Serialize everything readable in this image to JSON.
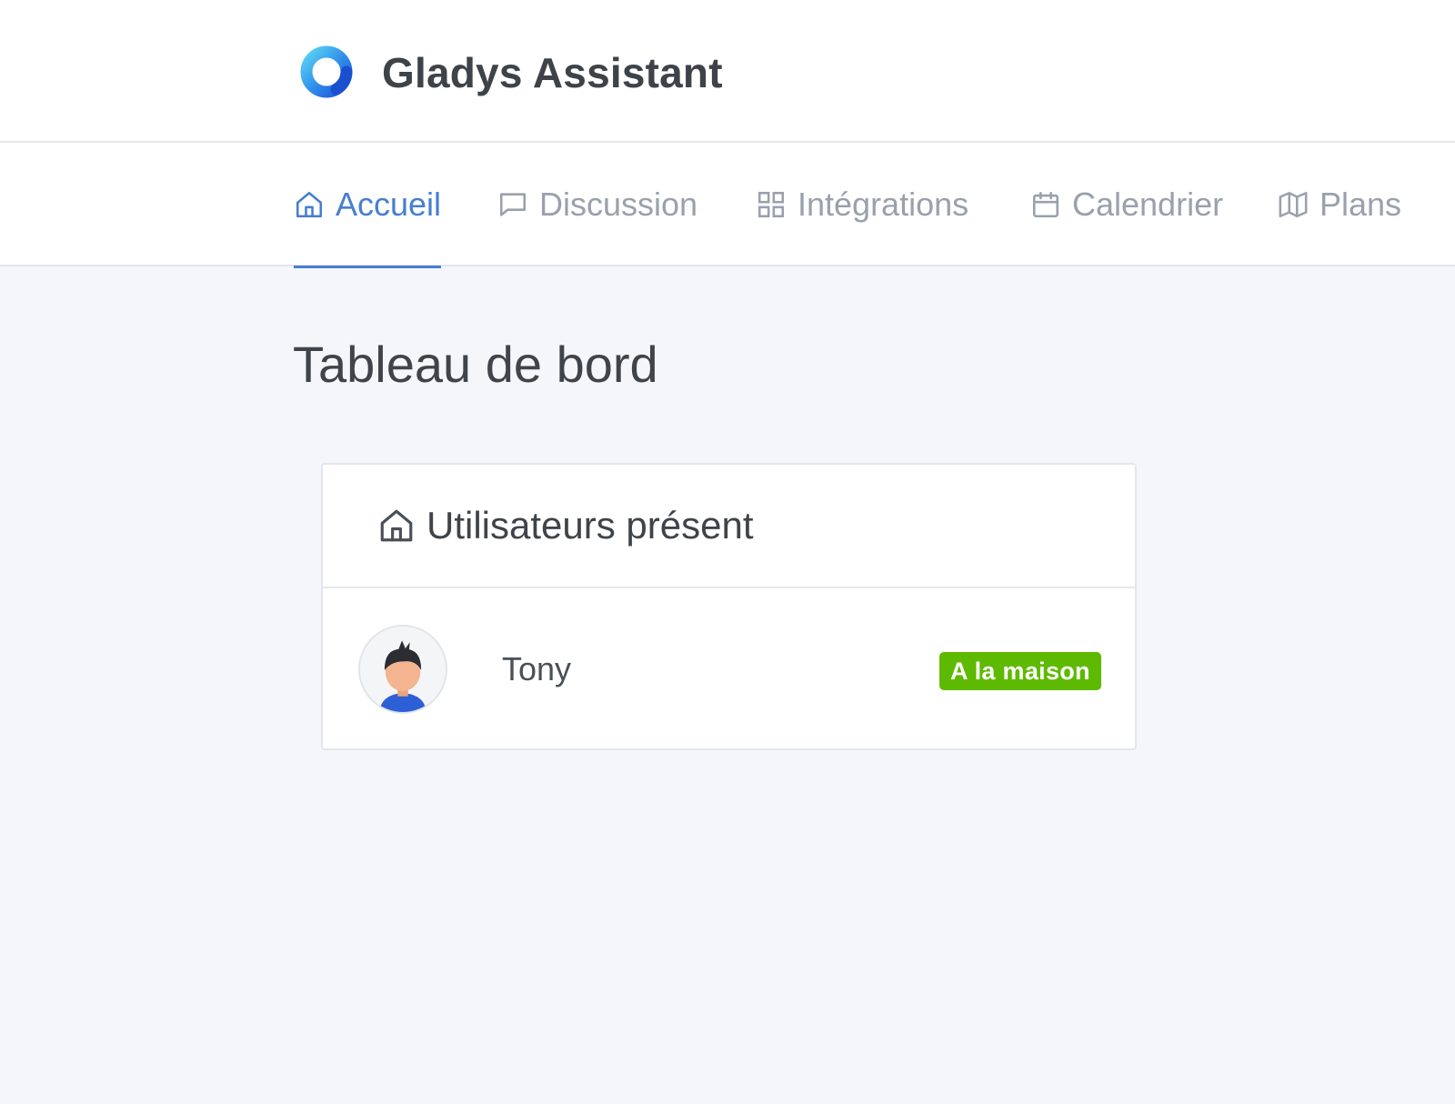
{
  "brand": {
    "name": "Gladys Assistant",
    "logo_icon": "gladys-logo-ring"
  },
  "nav": {
    "tabs": [
      {
        "label": "Accueil",
        "icon": "home-icon",
        "active": true
      },
      {
        "label": "Discussion",
        "icon": "chat-icon",
        "active": false
      },
      {
        "label": "Intégrations",
        "icon": "grid-icon",
        "active": false
      },
      {
        "label": "Calendrier",
        "icon": "calendar-icon",
        "active": false
      },
      {
        "label": "Plans",
        "icon": "map-icon",
        "active": false
      }
    ]
  },
  "page": {
    "title": "Tableau de bord"
  },
  "presence_card": {
    "title": "Utilisateurs présent",
    "icon": "home-icon",
    "users": [
      {
        "name": "Tony",
        "status": "A la maison",
        "status_color": "#5eba00",
        "avatar_icon": "user-avatar"
      }
    ]
  },
  "colors": {
    "accent": "#467fcf",
    "success": "#5eba00",
    "muted": "#9aa0ac",
    "background": "#f5f6fa"
  }
}
